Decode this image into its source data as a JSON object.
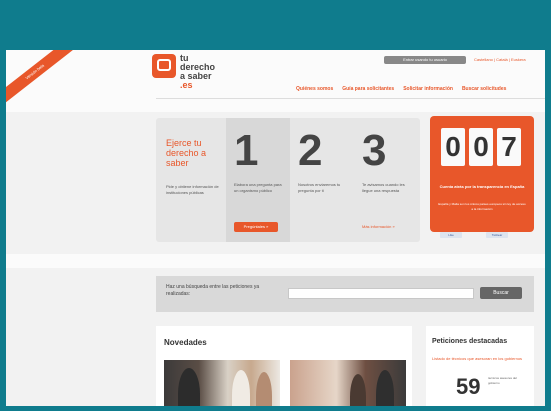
{
  "header": {
    "ribbon_text": "Versión beta",
    "logo_lines": [
      "tu",
      "derecho",
      "a saber",
      ".es"
    ],
    "access_button": "Entrar usando tu usuario",
    "lang_links": "Castellano | Català | Euskera",
    "nav": [
      "Quiénes somos",
      "Guía para solicitantes",
      "Solicitar información",
      "Buscar solicitudes"
    ]
  },
  "steps": {
    "title": "Ejerce tu derecho a saber",
    "intro": "Pide y obtiene información de instituciones públicas",
    "items": [
      {
        "number": "1",
        "desc": "Elabora una pregunta para un organismo público"
      },
      {
        "number": "2",
        "desc": "Nosotros enviaremos tu pregunta por ti"
      },
      {
        "number": "3",
        "desc": "Te avisamos cuando les llegue una respuesta"
      }
    ],
    "ask_button": "Pregúntales »",
    "learn_link": "Más información »"
  },
  "counter": {
    "digits": [
      "0",
      "0",
      "7"
    ],
    "label": "Cuenta atrás por la transparencia en España",
    "sub": "España y Malta son los únicos países europeos sin ley de acceso a la información",
    "share": [
      "Like",
      "Twittear"
    ]
  },
  "search": {
    "label": "Haz una búsqueda entre las peticiones ya realizadas:",
    "placeholder": "",
    "button": "Buscar"
  },
  "news": {
    "title": "Novedades"
  },
  "highlights": {
    "title": "Peticiones destacadas",
    "item": "Listado de técnicos que asesoran en los gobiernos",
    "count": "59",
    "count_label": "técnicos asesores del gobierno"
  },
  "colors": {
    "frame": "#0f7c8d",
    "accent": "#e8572a"
  }
}
